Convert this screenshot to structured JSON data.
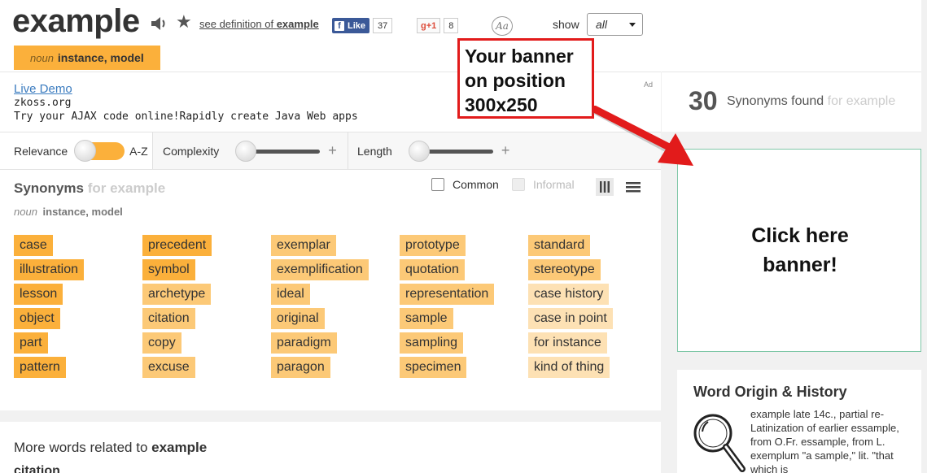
{
  "header": {
    "word": "example",
    "see_definition_prefix": "see definition of",
    "see_definition_word": "example",
    "fb_like_label": "Like",
    "fb_count": "37",
    "gplus_label": "+1",
    "gplus_count": "8",
    "font_toggle_label": "Aa",
    "show_label": "show",
    "show_value": "all",
    "pos_tag": {
      "pos": "noun",
      "sense": "instance, model"
    }
  },
  "ad": {
    "title": "Live Demo",
    "url": "zkoss.org",
    "description": "Try your AJAX code online!Rapidly create Java Web apps",
    "ad_label": "Ad"
  },
  "filters": {
    "relevance": "Relevance",
    "az": "A-Z",
    "complexity": "Complexity",
    "length": "Length",
    "plus": "+"
  },
  "synonyms": {
    "title": "Synonyms",
    "for_text": "for example",
    "pos": "noun",
    "sense": "instance, model",
    "common_label": "Common",
    "informal_label": "Informal",
    "columns": [
      [
        "case",
        "illustration",
        "lesson",
        "object",
        "part",
        "pattern"
      ],
      [
        "precedent",
        "symbol",
        "archetype",
        "citation",
        "copy",
        "excuse"
      ],
      [
        "exemplar",
        "exemplification",
        "ideal",
        "original",
        "paradigm",
        "paragon"
      ],
      [
        "prototype",
        "quotation",
        "representation",
        "sample",
        "sampling",
        "specimen"
      ],
      [
        "standard",
        "stereotype",
        "case history",
        "case in point",
        "for instance",
        "kind of thing"
      ]
    ],
    "colors": {
      "strong": "#fbb03b",
      "medium": "#fcc977",
      "light": "#fde1b4",
      "lightest": "#fdebd0"
    }
  },
  "more": {
    "label_prefix": "More words related to",
    "word": "example",
    "first": "citation"
  },
  "found": {
    "count": "30",
    "label": "Synonyms found",
    "for_text": "for example"
  },
  "banner": {
    "line1": "Click here",
    "line2": "banner!"
  },
  "callout": {
    "line1": "Your banner",
    "line2": "on position",
    "line3": "300x250"
  },
  "origin": {
    "title": "Word Origin & History",
    "text": "example late 14c., partial re-Latinization of earlier essample, from O.Fr. essample, from L. exemplum \"a sample,\" lit. \"that which is"
  }
}
